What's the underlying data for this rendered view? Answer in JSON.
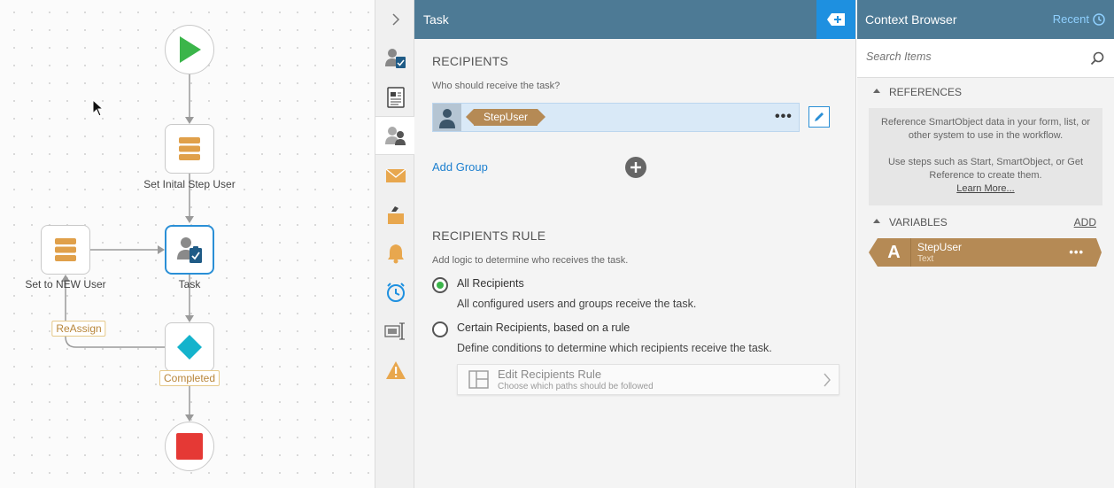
{
  "canvas": {
    "nodes": {
      "set_initial": "Set Inital Step User",
      "set_new": "Set to NEW User",
      "task": "Task"
    },
    "tags": {
      "reassign": "ReAssign",
      "completed": "Completed"
    }
  },
  "task_panel": {
    "title": "Task",
    "recipients": {
      "title": "RECIPIENTS",
      "subtitle": "Who should receive the task?",
      "recipient_chip": "StepUser",
      "add_group": "Add Group"
    },
    "rule": {
      "title": "RECIPIENTS RULE",
      "subtitle": "Add logic to determine who receives the task.",
      "options": [
        {
          "label": "All Recipients",
          "description": "All configured users and groups receive the task.",
          "selected": true
        },
        {
          "label": "Certain Recipients, based on a rule",
          "description": "Define conditions to determine which recipients receive the task.",
          "selected": false
        }
      ],
      "edit_rule": {
        "title": "Edit Recipients Rule",
        "subtitle": "Choose which paths should be followed"
      }
    }
  },
  "context_browser": {
    "title": "Context Browser",
    "recent": "Recent",
    "search_placeholder": "Search Items",
    "references": {
      "title": "REFERENCES",
      "text1": "Reference SmartObject data in your form, list, or other system to use in the workflow.",
      "text2": "Use steps such as Start, SmartObject, or Get Reference to create them.",
      "learn_more": "Learn More..."
    },
    "variables": {
      "title": "VARIABLES",
      "add": "ADD",
      "items": [
        {
          "type_letter": "A",
          "name": "StepUser",
          "kind": "Text"
        }
      ]
    }
  },
  "colors": {
    "header": "#4d7a95",
    "accent_blue": "#1e90e0",
    "variable_brown": "#b58a55",
    "start_green": "#3bb54a",
    "stop_red": "#e53935",
    "decision_teal": "#14b3cc"
  }
}
